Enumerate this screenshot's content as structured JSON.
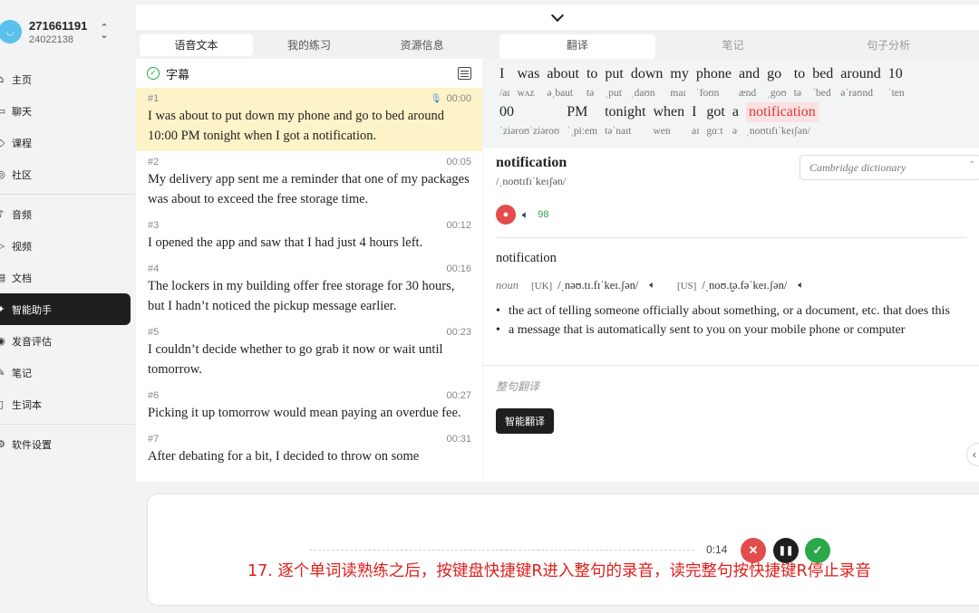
{
  "profile": {
    "id": "271661191",
    "sub": "24022138"
  },
  "nav": [
    {
      "label": "主页",
      "icon": "home-icon",
      "glyph": "⌂"
    },
    {
      "label": "聊天",
      "icon": "chat-icon",
      "glyph": "▭"
    },
    {
      "label": "课程",
      "icon": "graduation-cap-icon",
      "glyph": "◇"
    },
    {
      "label": "社区",
      "icon": "community-icon",
      "glyph": "◎"
    },
    {
      "label": "音频",
      "icon": "audio-icon",
      "glyph": "♪"
    },
    {
      "label": "视频",
      "icon": "video-icon",
      "glyph": "▷"
    },
    {
      "label": "文档",
      "icon": "document-icon",
      "glyph": "▤"
    },
    {
      "label": "智能助手",
      "icon": "assistant-icon",
      "glyph": "✦"
    },
    {
      "label": "发音评估",
      "icon": "pronunciation-icon",
      "glyph": "◉"
    },
    {
      "label": "笔记",
      "icon": "note-icon",
      "glyph": "✎"
    },
    {
      "label": "生词本",
      "icon": "wordbook-icon",
      "glyph": "▯"
    },
    {
      "label": "软件设置",
      "icon": "settings-icon",
      "glyph": "⚙"
    }
  ],
  "left_tabs": [
    "语音文本",
    "我的练习",
    "资源信息"
  ],
  "subtitle_header": "字幕",
  "segments": [
    {
      "num": "#1",
      "time": "00:00",
      "text": "I was about to put down my phone and go to bed around 10:00 PM tonight when I got a notification."
    },
    {
      "num": "#2",
      "time": "00:05",
      "text": "My delivery app sent me a reminder that one of my packages was about to exceed the free storage time."
    },
    {
      "num": "#3",
      "time": "00:12",
      "text": "I opened the app and saw that I had just 4 hours left."
    },
    {
      "num": "#4",
      "time": "00:16",
      "text": "The lockers in my building offer free storage for 30 hours, but I hadn’t noticed the pickup message earlier."
    },
    {
      "num": "#5",
      "time": "00:23",
      "text": "I couldn’t decide whether to go grab it now or wait until tomorrow."
    },
    {
      "num": "#6",
      "time": "00:27",
      "text": "Picking it up tomorrow would mean paying an overdue fee."
    },
    {
      "num": "#7",
      "time": "00:31",
      "text": "After debating for a bit, I decided to throw on some"
    }
  ],
  "right_tabs": [
    "翻译",
    "笔记",
    "句子分析"
  ],
  "sentence_words": [
    {
      "w": "I",
      "ipa": "/aɪ"
    },
    {
      "w": "was",
      "ipa": "wʌz"
    },
    {
      "w": "about",
      "ipa": "əˌbaut"
    },
    {
      "w": "to",
      "ipa": "tə"
    },
    {
      "w": "put",
      "ipa": "ˌput"
    },
    {
      "w": "down",
      "ipa": "ˌdaʊn"
    },
    {
      "w": "my",
      "ipa": "maɪ"
    },
    {
      "w": "phone",
      "ipa": "ˈfoʊn"
    },
    {
      "w": "and",
      "ipa": "ænd"
    },
    {
      "w": "go",
      "ipa": "ˌgoʊ"
    },
    {
      "w": "to",
      "ipa": "tə"
    },
    {
      "w": "bed",
      "ipa": "ˈbed"
    },
    {
      "w": "around",
      "ipa": "əˈraʊnd"
    },
    {
      "w": "10",
      "ipa": "ˈten"
    },
    {
      "w": "00",
      "ipa": "ˈziəroʊˈziəroʊ"
    },
    {
      "w": "PM",
      "ipa": "ˈˌpiːem"
    },
    {
      "w": "tonight",
      "ipa": "təˈnaɪt"
    },
    {
      "w": "when",
      "ipa": "wen"
    },
    {
      "w": "I",
      "ipa": "aɪ"
    },
    {
      "w": "got",
      "ipa": "gɑːt"
    },
    {
      "w": "a",
      "ipa": "ə"
    },
    {
      "w": "notification",
      "ipa": "ˌnoʊtɪfɪˈkeɪʃən/",
      "highlight": true
    }
  ],
  "dict": {
    "word": "notification",
    "ipa": "/ˌnoʊtɪfɪˈkeɪʃən/",
    "source": "Cambridge dictionary",
    "score": "98",
    "entry_word": "notification",
    "pos": "noun",
    "uk_label": "[UK]",
    "uk_ipa": "/ˌnəʊ.tɪ.fɪˈkeɪ.ʃən/",
    "us_label": "[US]",
    "us_ipa": "/ˌnoʊ.t̬ə.fəˈkeɪ.ʃən/",
    "definitions": [
      "the act of telling someone officially about something, or a document, etc. that does this",
      "a message that is automatically sent to you on your mobile phone or computer"
    ],
    "translate_label": "整句翻译",
    "translate_button": "智能翻译"
  },
  "recorder": {
    "time": "0:14"
  },
  "caption": "17. 逐个单词读熟练之后，按键盘快捷键R进入整句的录音，读完整句按快捷键R停止录音"
}
